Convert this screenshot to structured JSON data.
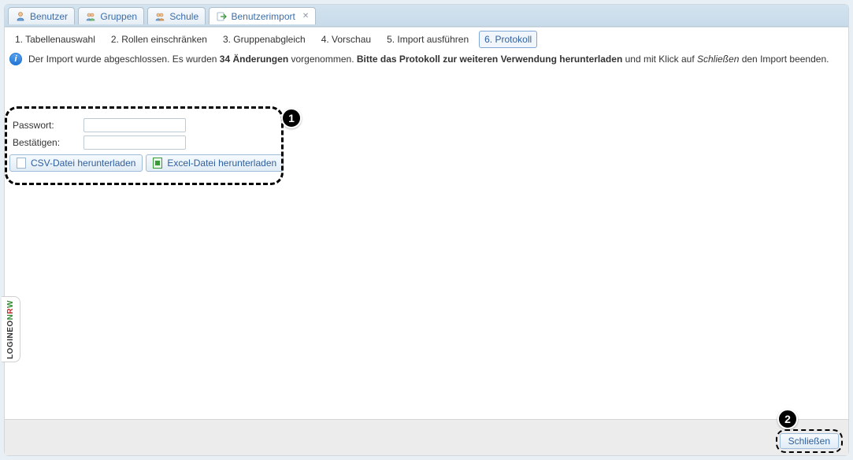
{
  "tabs": {
    "benutzer": "Benutzer",
    "gruppen": "Gruppen",
    "schule": "Schule",
    "benutzerimport": "Benutzerimport"
  },
  "steps": {
    "s1": "1. Tabellenauswahl",
    "s2": "2. Rollen einschränken",
    "s3": "3. Gruppenabgleich",
    "s4": "4. Vorschau",
    "s5": "5. Import ausführen",
    "s6": "6. Protokoll"
  },
  "info": {
    "pre1": "Der Import wurde abgeschlossen. Es wurden ",
    "changes": "34 Änderungen",
    "mid1": " vorgenommen. ",
    "bold": "Bitte das Protokoll zur weiteren Verwendung herunterladen",
    "mid2": " und mit Klick auf ",
    "italic": "Schließen",
    "post": " den Import beenden."
  },
  "form": {
    "password_label": "Passwort:",
    "confirm_label": "Bestätigen:",
    "password_value": "",
    "confirm_value": ""
  },
  "buttons": {
    "csv": "CSV-Datei herunterladen",
    "excel": "Excel-Datei herunterladen",
    "close": "Schließen"
  },
  "callouts": {
    "one": "1",
    "two": "2"
  },
  "branding": {
    "logineo": "LOGINEO",
    "nrw_n": "N",
    "nrw_r": "R",
    "nrw_w": "W"
  }
}
